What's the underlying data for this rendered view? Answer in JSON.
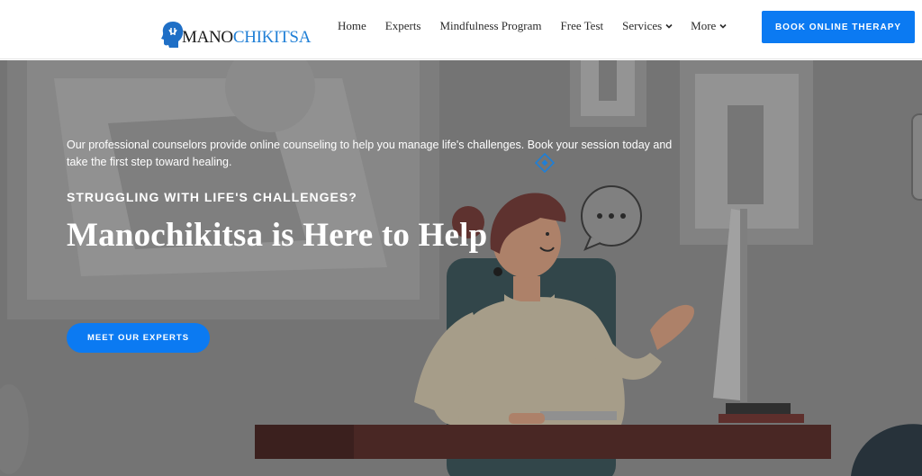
{
  "brand": {
    "logo_part1": "MANO",
    "logo_part2": "CHIKITSA"
  },
  "nav": {
    "items": [
      {
        "label": "Home",
        "dropdown": false
      },
      {
        "label": "Experts",
        "dropdown": false
      },
      {
        "label": "Mindfulness Program",
        "dropdown": false
      },
      {
        "label": "Free Test",
        "dropdown": false
      },
      {
        "label": "Services",
        "dropdown": true
      },
      {
        "label": "More",
        "dropdown": true
      }
    ],
    "cta": "BOOK ONLINE THERAPY"
  },
  "hero": {
    "description": "Our professional counselors provide online counseling to help you manage life's challenges. Book your session today and take the first step toward healing.",
    "subheading": "STRUGGLING WITH LIFE'S CHALLENGES?",
    "title": "Manochikitsa is Here to Help",
    "button": "MEET OUR EXPERTS"
  },
  "colors": {
    "accent": "#0b7af2",
    "logo_blue": "#1f7fd6"
  },
  "icons": [
    "logo-head-icon",
    "chevron-down-icon",
    "diamond-icon",
    "speech-bubble-icon"
  ]
}
